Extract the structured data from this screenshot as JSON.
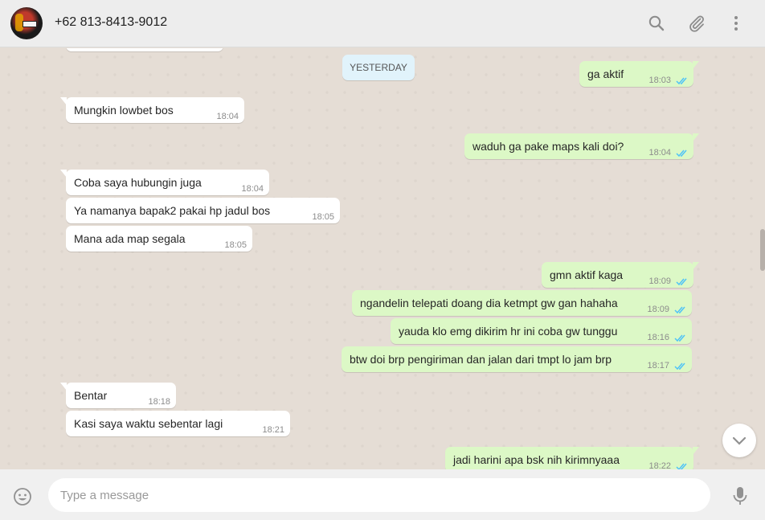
{
  "header": {
    "contact_name": "+62 813-8413-9012",
    "icons": [
      "search-icon",
      "attach-icon",
      "menu-icon"
    ]
  },
  "chat": {
    "date_divider": "YESTERDAY",
    "messages": [
      {
        "dir": "out",
        "text": "ga aktif",
        "time": "18:03",
        "status": "read"
      },
      {
        "dir": "in",
        "text": "Mungkin lowbet bos",
        "time": "18:04"
      },
      {
        "dir": "out",
        "text": "waduh ga pake maps kali doi?",
        "time": "18:04",
        "status": "read"
      },
      {
        "dir": "in",
        "text": "Coba saya hubungin juga",
        "time": "18:04"
      },
      {
        "dir": "in",
        "text": "Ya namanya bapak2 pakai hp jadul bos",
        "time": "18:05"
      },
      {
        "dir": "in",
        "text": "Mana ada map segala",
        "time": "18:05"
      },
      {
        "dir": "out",
        "text": "gmn aktif kaga",
        "time": "18:09",
        "status": "read"
      },
      {
        "dir": "out",
        "text": "ngandelin telepati doang dia ketmpt gw gan hahaha",
        "time": "18:09",
        "status": "read"
      },
      {
        "dir": "out",
        "text": "yauda klo emg dikirim hr ini coba gw tunggu",
        "time": "18:16",
        "status": "read"
      },
      {
        "dir": "out",
        "text": "btw doi brp pengiriman dan jalan dari tmpt lo jam brp",
        "time": "18:17",
        "status": "read"
      },
      {
        "dir": "in",
        "text": "Bentar",
        "time": "18:18"
      },
      {
        "dir": "in",
        "text": "Kasi saya waktu sebentar lagi",
        "time": "18:21"
      },
      {
        "dir": "out",
        "text": "jadi harini apa bsk nih kirimnyaaa",
        "time": "18:22",
        "status": "read"
      }
    ]
  },
  "footer": {
    "input_placeholder": "Type a message",
    "input_value": "",
    "icons": [
      "emoji-icon",
      "mic-icon"
    ]
  },
  "colors": {
    "background": "#e5ddd5",
    "incoming_bubble": "#ffffff",
    "outgoing_bubble": "#dcf8c6",
    "date_chip": "#e1f3fb",
    "read_ticks": "#4fc3f7",
    "header": "#ededed"
  }
}
